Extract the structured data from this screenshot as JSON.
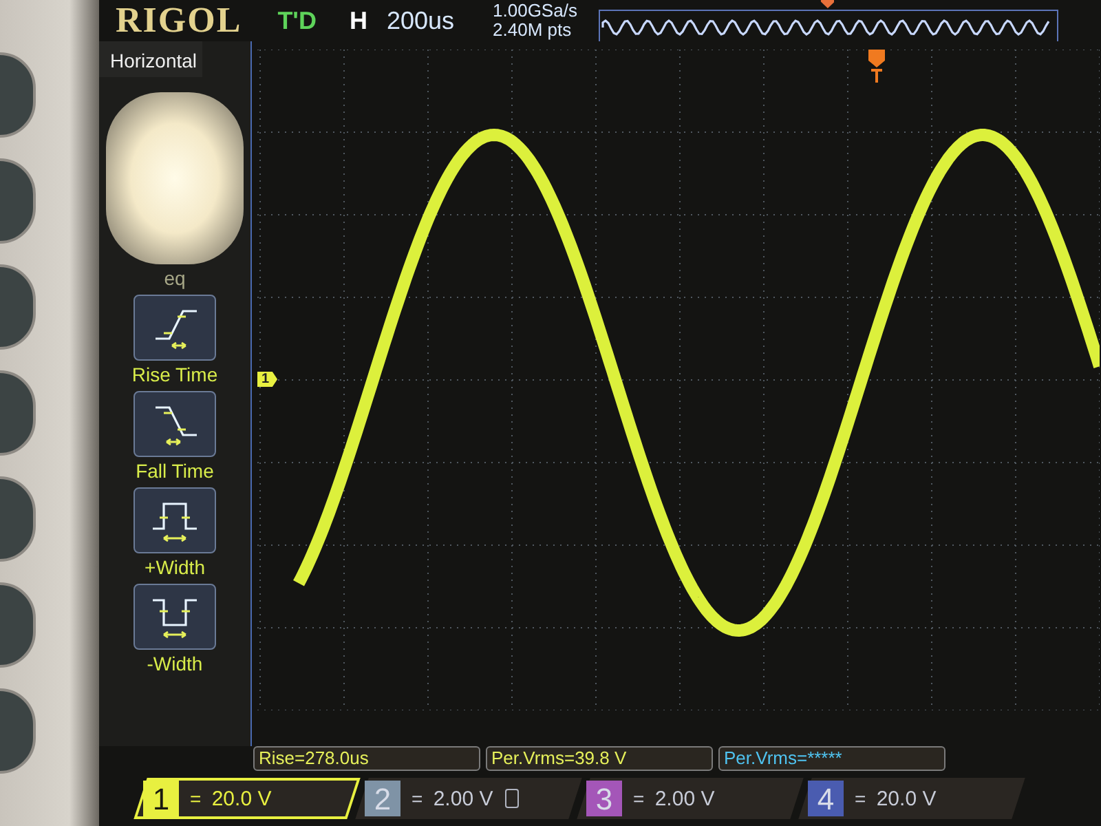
{
  "header": {
    "brand": "RIGOL",
    "trigger_status": "T'D",
    "timebase_label": "H",
    "timebase": "200us",
    "sample_rate": "1.00GSa/s",
    "memory_depth": "2.40M pts"
  },
  "menu": {
    "title": "Horizontal",
    "items": [
      {
        "kind": "hidden",
        "label": "eq"
      },
      {
        "kind": "rise",
        "label": "Rise Time"
      },
      {
        "kind": "fall",
        "label": "Fall Time"
      },
      {
        "kind": "pwidth",
        "label": "+Width"
      },
      {
        "kind": "nwidth",
        "label": "-Width"
      }
    ]
  },
  "plot": {
    "channel_marker": "1"
  },
  "measurements": [
    {
      "text": "Rise=278.0us",
      "color": "#e6f05a"
    },
    {
      "text": "Per.Vrms=39.8 V",
      "color": "#e6f05a"
    },
    {
      "text": "Per.Vrms=*****",
      "color": "#4fc3f0"
    }
  ],
  "channels": [
    {
      "number": "1",
      "coupling": "=",
      "scale": "20.0 V",
      "color": "#e8f040",
      "selected": true
    },
    {
      "number": "2",
      "coupling": "=",
      "scale": "2.00 V",
      "color": "#7f93a6",
      "selected": false
    },
    {
      "number": "3",
      "coupling": "=",
      "scale": "2.00 V",
      "color": "#a456b8",
      "selected": false
    },
    {
      "number": "4",
      "coupling": "=",
      "scale": "20.0 V",
      "color": "#4a5cb0",
      "selected": false
    }
  ]
}
